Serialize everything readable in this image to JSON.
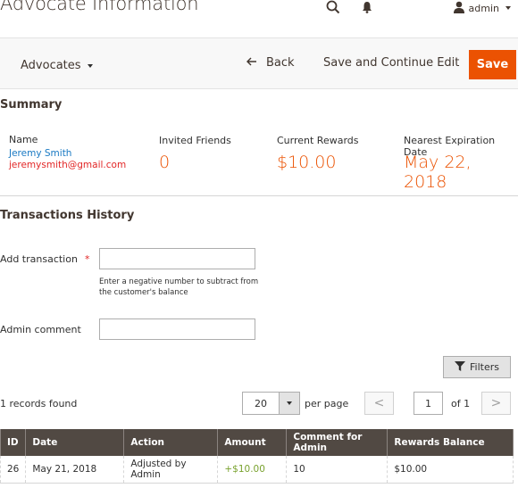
{
  "header": {
    "title": "Advocate Information",
    "user_name": "admin",
    "icons": {
      "search": "search-icon",
      "notifications": "bell-icon",
      "user": "user-icon"
    }
  },
  "action_bar": {
    "scope_label": "Advocates",
    "back_label": "Back",
    "save_continue_label": "Save and Continue Edit",
    "save_label": "Save",
    "save_color": "#eb5202"
  },
  "summary": {
    "title": "Summary",
    "name_label": "Name",
    "name": "Jeremy Smith",
    "email": "jeremysmith@gmail.com",
    "invited_label": "Invited Friends",
    "invited_value": "0",
    "rewards_label": "Current Rewards",
    "rewards_value": "$10.00",
    "expiration_label": "Nearest Expiration Date",
    "expiration_value": "May 22, 2018",
    "accent_color": "#eb5202"
  },
  "transactions": {
    "title": "Transactions History",
    "add_label": "Add transaction",
    "required_mark": "*",
    "add_value": "",
    "add_note": "Enter a negative number to subtract from the customer's balance",
    "comment_label": "Admin comment",
    "comment_value": ""
  },
  "grid": {
    "filters_label": "Filters",
    "records_found": "1 records found",
    "per_page_value": "20",
    "per_page_label": "per page",
    "prev_label": "<",
    "next_label": ">",
    "current_page": "1",
    "page_of": "of 1",
    "columns": [
      "ID",
      "Date",
      "Action",
      "Amount",
      "Comment for Admin",
      "Rewards Balance"
    ],
    "rows": [
      {
        "id": "26",
        "date": "May 21, 2018",
        "action": "Adjusted by Admin",
        "amount": "+$10.00",
        "comment": "10",
        "balance": "$10.00"
      }
    ]
  }
}
